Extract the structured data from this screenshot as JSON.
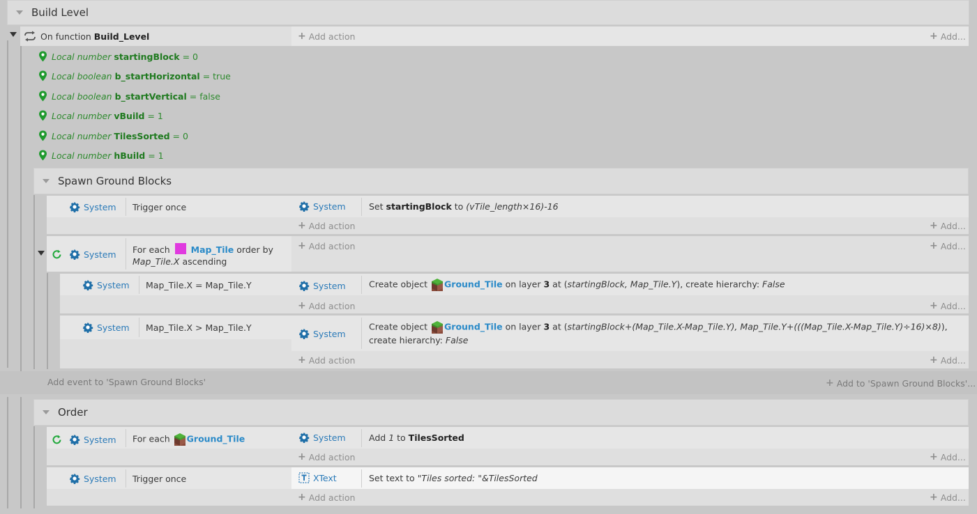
{
  "colors": {
    "background": "#c8c8c8",
    "panel": "#dfdfdf",
    "link": "#2a7ab8",
    "local_var": "#2e8a2e",
    "map_tile": "#e03adf"
  },
  "add_action": "Add action",
  "add_more": "Add...",
  "system_label": "System",
  "groups": {
    "build_level": {
      "title": "Build Level"
    },
    "spawn": {
      "title": "Spawn Ground Blocks"
    },
    "order": {
      "title": "Order"
    }
  },
  "function_event": {
    "prefix": "On function",
    "name": "Build_Level",
    "icon": "function-loop-icon"
  },
  "locals": [
    {
      "kind": "Local number",
      "name": "startingBlock",
      "value": "= 0"
    },
    {
      "kind": "Local boolean",
      "name": "b_startHorizontal",
      "value": "= true"
    },
    {
      "kind": "Local boolean",
      "name": "b_startVertical",
      "value": "= false"
    },
    {
      "kind": "Local number",
      "name": "vBuild",
      "value": "= 1"
    },
    {
      "kind": "Local number",
      "name": "TilesSorted",
      "value": "= 0"
    },
    {
      "kind": "Local number",
      "name": "hBuild",
      "value": "= 1"
    }
  ],
  "spawn_events": {
    "e1": {
      "condition": "Trigger once",
      "action_object": "System",
      "action": {
        "pre": "Set",
        "var": "startingBlock",
        "mid": "to",
        "expr": "(vTile_length×16)-16"
      }
    },
    "e2": {
      "cond_pre": "For each",
      "object": "Map_Tile",
      "cond_post": "order by",
      "cond_line2": "Map_Tile.X",
      "cond_line2_post": "ascending"
    },
    "e3": {
      "condition": "Map_Tile.X = Map_Tile.Y",
      "action": {
        "pre": "Create object",
        "object": "Ground_Tile",
        "mid": "on layer",
        "layer": "3",
        "at": "at (",
        "expr": "startingBlock, Map_Tile.Y",
        "post": "), create hierarchy:",
        "hier": "False"
      }
    },
    "e4": {
      "condition": "Map_Tile.X > Map_Tile.Y",
      "action": {
        "pre": "Create object",
        "object": "Ground_Tile",
        "mid": "on layer",
        "layer": "3",
        "at": "at (",
        "expr": "startingBlock+(Map_Tile.X-Map_Tile.Y), Map_Tile.Y+(((Map_Tile.X-Map_Tile.Y)÷16)×8)",
        "post": "), create hierarchy:",
        "hier": "False"
      }
    },
    "add_event": "Add event to 'Spawn Ground Blocks'",
    "add_to": "Add to 'Spawn Ground Blocks'..."
  },
  "order_events": {
    "e1": {
      "cond_pre": "For each",
      "object": "Ground_Tile",
      "action": {
        "pre": "Add",
        "value": "1",
        "mid": "to",
        "var": "TilesSorted"
      }
    },
    "e2": {
      "condition": "Trigger once",
      "action_object": "XText",
      "action": {
        "pre": "Set text to",
        "expr": "\"Tiles sorted: \"&TilesSorted"
      }
    }
  }
}
